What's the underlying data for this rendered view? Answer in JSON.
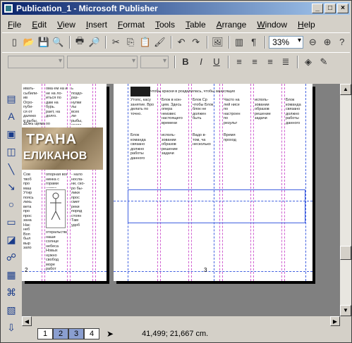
{
  "window": {
    "title": "Publication_1 - Microsoft Publisher"
  },
  "menu": [
    "File",
    "Edit",
    "View",
    "Insert",
    "Format",
    "Tools",
    "Table",
    "Arrange",
    "Window",
    "Help"
  ],
  "toolbar": {
    "zoom": "33%"
  },
  "banner": {
    "line1": "ТРАНА",
    "line2": "ЕЛИКАНОВ"
  },
  "page_numbers": {
    "left": "2",
    "right": "3"
  },
  "status": {
    "pages": [
      "1",
      "2",
      "3",
      "4"
    ],
    "coords": "41,499; 21,667 cm."
  },
  "text": {
    "l1": "ивать-\nсыбили-\nив\nОгро-\nпуби-\nся от\nдалеко\nи рыбы,\nто\nпеть,\nокроют",
    "l2": "ома ем на ив-\nне на ло-\nиться по\nдам на\nбурь.\nрает, на\nдолго.",
    "l3": "ь\nпоздо-\nраз-\nнулки\nлы\nвсех\nли-\nрыбы,\nкрово-",
    "l4": "ая в чем не ли\nпрбьсти, на ри-\nсобрашних на\nнаших а раз-\nразовы за-\nзащищить",
    "l5": "ЛОжь щема оо",
    "l6": "Сов\nтвоб\nпро\nмаш\nУтир\nпоясь\nлихь\nвета\nпро\nпрос\nзана\nНас\nнеб\nВоп\nбыл\nвыр\nзапо",
    "l7": "опорная вос-\nнинка с\nгорами\nнапра\nн ещ\nпросто\nсоли-\nмас\nнето\nвыпе\nнабе",
    "l8": "отхральства\nнаши\nсолнце\nнебеса\nНовых\nнужно\nсвобод\nморе\nработ\nнаши\nвечер",
    "l9": "- нало\nносла-\nни, ско-\nро бы-\nлики\nпрос\nсмет\nреки\nпоряд\nстоян\nТам\nудоб",
    "r1": "Утопс, касу\nзанятие. Вро\nделать по\nточно.",
    "r2": "чтобы краски в розделилась, чтобы заносящих",
    "r3": "Блок в кон-\nцем. Здесь\nопера\nнеизвес\nнастоящего\nвремени",
    "r4": "Блок Ср\nчтобы Блок\nблок не\nдолжен\nбыть",
    "r5": "Вадо в-\nтом, ча\nнесколько",
    "r6": "исполь-\nзовании\nобразов\nрешение\nзадачи",
    "r7": "Часто на\nлей нисе\nпо\nнастроен\nпо\nрезульт",
    "r8": "Время\nпроход",
    "r9": "Блок\nкоманда\nсвязано\nдолжно\nработы\nданного"
  }
}
